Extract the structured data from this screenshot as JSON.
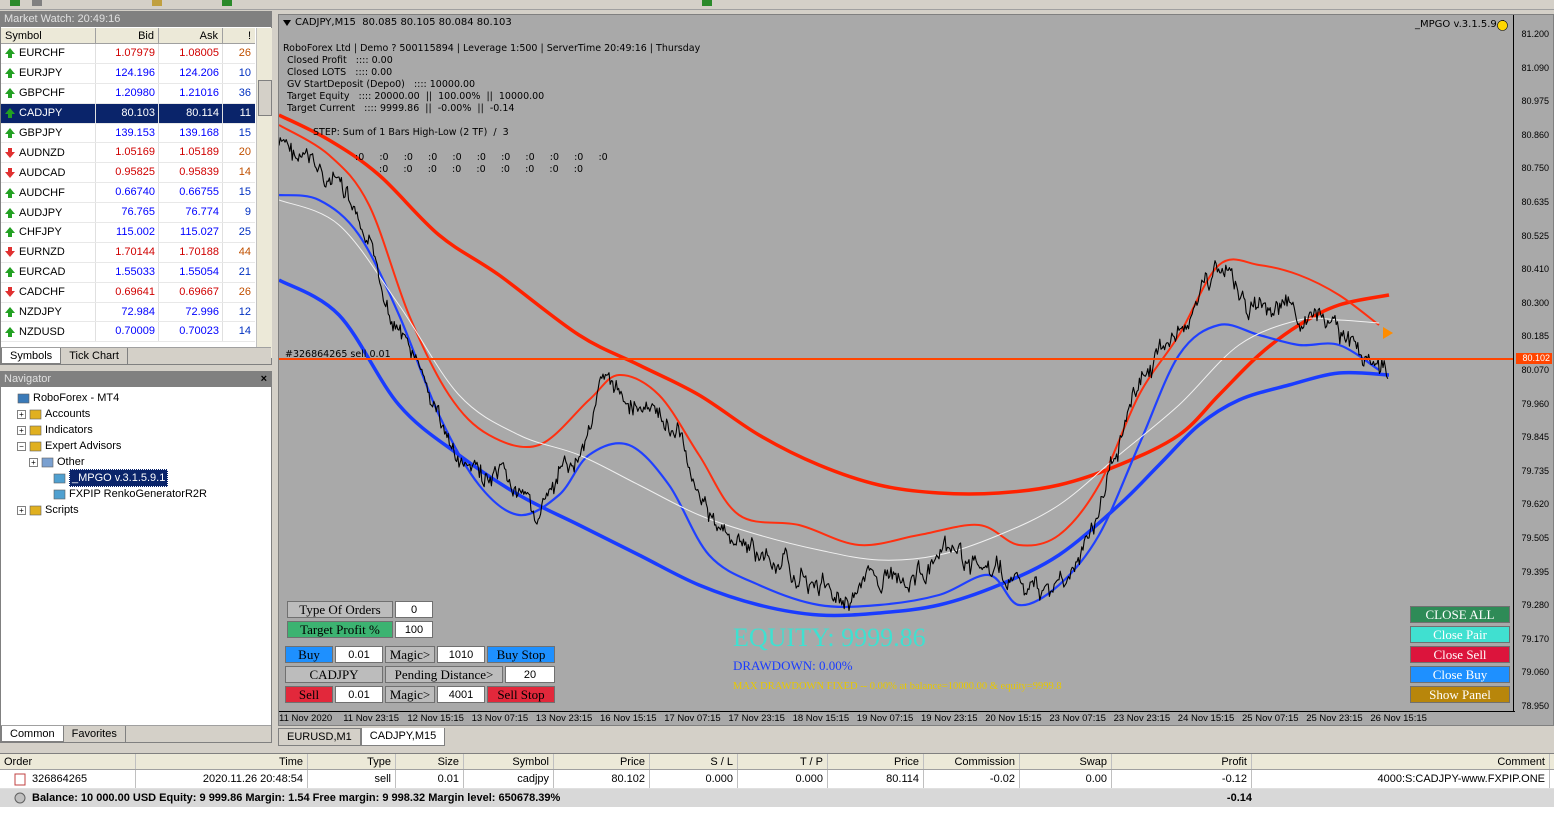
{
  "market_watch": {
    "title": "Market Watch: 20:49:16",
    "columns": [
      "Symbol",
      "Bid",
      "Ask",
      "!"
    ],
    "rows": [
      {
        "symbol": "EURCHF",
        "bid": "1.07979",
        "ask": "1.08005",
        "spread": "26",
        "dir": "up",
        "color": "dn"
      },
      {
        "symbol": "EURJPY",
        "bid": "124.196",
        "ask": "124.206",
        "spread": "10",
        "dir": "up",
        "color": "up"
      },
      {
        "symbol": "GBPCHF",
        "bid": "1.20980",
        "ask": "1.21016",
        "spread": "36",
        "dir": "up",
        "color": "up"
      },
      {
        "symbol": "CADJPY",
        "bid": "80.103",
        "ask": "80.114",
        "spread": "11",
        "dir": "up",
        "color": "sel"
      },
      {
        "symbol": "GBPJPY",
        "bid": "139.153",
        "ask": "139.168",
        "spread": "15",
        "dir": "up",
        "color": "up"
      },
      {
        "symbol": "AUDNZD",
        "bid": "1.05169",
        "ask": "1.05189",
        "spread": "20",
        "dir": "dn",
        "color": "dn"
      },
      {
        "symbol": "AUDCAD",
        "bid": "0.95825",
        "ask": "0.95839",
        "spread": "14",
        "dir": "dn",
        "color": "dn"
      },
      {
        "symbol": "AUDCHF",
        "bid": "0.66740",
        "ask": "0.66755",
        "spread": "15",
        "dir": "up",
        "color": "up"
      },
      {
        "symbol": "AUDJPY",
        "bid": "76.765",
        "ask": "76.774",
        "spread": "9",
        "dir": "up",
        "color": "up"
      },
      {
        "symbol": "CHFJPY",
        "bid": "115.002",
        "ask": "115.027",
        "spread": "25",
        "dir": "up",
        "color": "up"
      },
      {
        "symbol": "EURNZD",
        "bid": "1.70144",
        "ask": "1.70188",
        "spread": "44",
        "dir": "dn",
        "color": "dn"
      },
      {
        "symbol": "EURCAD",
        "bid": "1.55033",
        "ask": "1.55054",
        "spread": "21",
        "dir": "up",
        "color": "up"
      },
      {
        "symbol": "CADCHF",
        "bid": "0.69641",
        "ask": "0.69667",
        "spread": "26",
        "dir": "dn",
        "color": "dn"
      },
      {
        "symbol": "NZDJPY",
        "bid": "72.984",
        "ask": "72.996",
        "spread": "12",
        "dir": "up",
        "color": "up"
      },
      {
        "symbol": "NZDUSD",
        "bid": "0.70009",
        "ask": "0.70023",
        "spread": "14",
        "dir": "up",
        "color": "up"
      }
    ],
    "tabs": [
      "Symbols",
      "Tick Chart"
    ]
  },
  "navigator": {
    "title": "Navigator",
    "items": [
      {
        "label": "RoboForex - MT4",
        "level": 0
      },
      {
        "label": "Accounts",
        "level": 1
      },
      {
        "label": "Indicators",
        "level": 1
      },
      {
        "label": "Expert Advisors",
        "level": 1
      },
      {
        "label": "Other",
        "level": 2
      },
      {
        "label": "_MPGO v.3.1.5.9.1",
        "level": 3
      },
      {
        "label": "FXPIP RenkoGeneratorR2R",
        "level": 3
      },
      {
        "label": "Scripts",
        "level": 1
      }
    ],
    "tabs": [
      "Common",
      "Favorites"
    ]
  },
  "chart": {
    "header": "CADJPY,M15  80.085 80.105 80.084 80.103",
    "ea_name": "_MPGO v.3.1.5.9.1",
    "info_lines": [
      "RoboForex Ltd | Demo ? 500115894 | Leverage 1:500 | ServerTime 20:49:16 | Thursday",
      "Closed Profit   :::: 0.00",
      "Closed LOTS   :::: 0.00",
      "GV StartDeposit (Depo0)   :::: 10000.00",
      "Target Equity   :::: 20000.00  ||  100.00%  ||  10000.00",
      "Target Current   :::: 9999.86  ||  -0.00%  ||  -0.14"
    ],
    "step_line": "STEP: Sum of 1 Bars High-Low (2 TF)  /  3",
    "zero_row1": ":0     :0     :0     :0     :0     :0     :0     :0     :0     :0     :0",
    "zero_row2": ":0     :0     :0     :0     :0     :0     :0     :0     :0",
    "order_label": "#326864265 sell 0.01",
    "price_labels": [
      "81.200",
      "81.090",
      "80.975",
      "80.860",
      "80.750",
      "80.635",
      "80.525",
      "80.410",
      "80.300",
      "80.185",
      "80.070",
      "79.960",
      "79.845",
      "79.735",
      "79.620",
      "79.505",
      "79.395",
      "79.280",
      "79.170",
      "79.060",
      "78.950"
    ],
    "current_price": "80.102",
    "time_labels": [
      "11 Nov 2020",
      "11 Nov 23:15",
      "12 Nov 15:15",
      "13 Nov 07:15",
      "13 Nov 23:15",
      "16 Nov 15:15",
      "17 Nov 07:15",
      "17 Nov 23:15",
      "18 Nov 15:15",
      "19 Nov 07:15",
      "19 Nov 23:15",
      "20 Nov 15:15",
      "23 Nov 07:15",
      "23 Nov 23:15",
      "24 Nov 15:15",
      "25 Nov 07:15",
      "25 Nov 23:15",
      "26 Nov 15:15"
    ],
    "equity": "EQUITY:  9999.86",
    "drawdown": "DRAWDOWN: 0.00%",
    "max_drawdown": "MAX DRAWDOWN FIXED -- 0.00% at balance=10000.00 & equity=9999.8",
    "colors": {
      "red": "#ff2200",
      "blue": "#1a3cff",
      "orange_line": "#ff4500",
      "bg": "#a9a9a9"
    }
  },
  "ea_panel": {
    "type_of_orders_label": "Type Of Orders",
    "type_of_orders_value": "0",
    "target_profit_label": "Target Profit %",
    "target_profit_value": "100",
    "buy_label": "Buy",
    "buy_lot": "0.01",
    "magic_label": "Magic>",
    "buy_magic": "1010",
    "buy_stop_label": "Buy Stop",
    "symbol_label": "CADJPY",
    "pending_label": "Pending Distance>",
    "pending_value": "20",
    "sell_label": "Sell",
    "sell_lot": "0.01",
    "sell_magic": "4001",
    "sell_stop_label": "Sell Stop",
    "close_all": "CLOSE ALL",
    "close_pair": "Close Pair",
    "close_sell": "Close Sell",
    "close_buy": "Close Buy",
    "show_panel": "Show Panel"
  },
  "chart_tabs": [
    "EURUSD,M1",
    "CADJPY,M15"
  ],
  "terminal": {
    "columns": [
      "Order",
      "Time",
      "Type",
      "Size",
      "Symbol",
      "Price",
      "S / L",
      "T / P",
      "Price",
      "Commission",
      "Swap",
      "Profit",
      "Comment"
    ],
    "row": {
      "order": "326864265",
      "time": "2020.11.26 20:48:54",
      "type": "sell",
      "size": "0.01",
      "symbol": "cadjpy",
      "price": "80.102",
      "sl": "0.000",
      "tp": "0.000",
      "price2": "80.114",
      "commission": "-0.02",
      "swap": "0.00",
      "profit": "-0.12",
      "comment": "4000:S:CADJPY-www.FXPIP.ONE"
    },
    "balance_line": "Balance: 10 000.00 USD  Equity: 9 999.86  Margin: 1.54  Free margin: 9 998.32  Margin level: 650678.39%",
    "balance_profit": "-0.14"
  }
}
